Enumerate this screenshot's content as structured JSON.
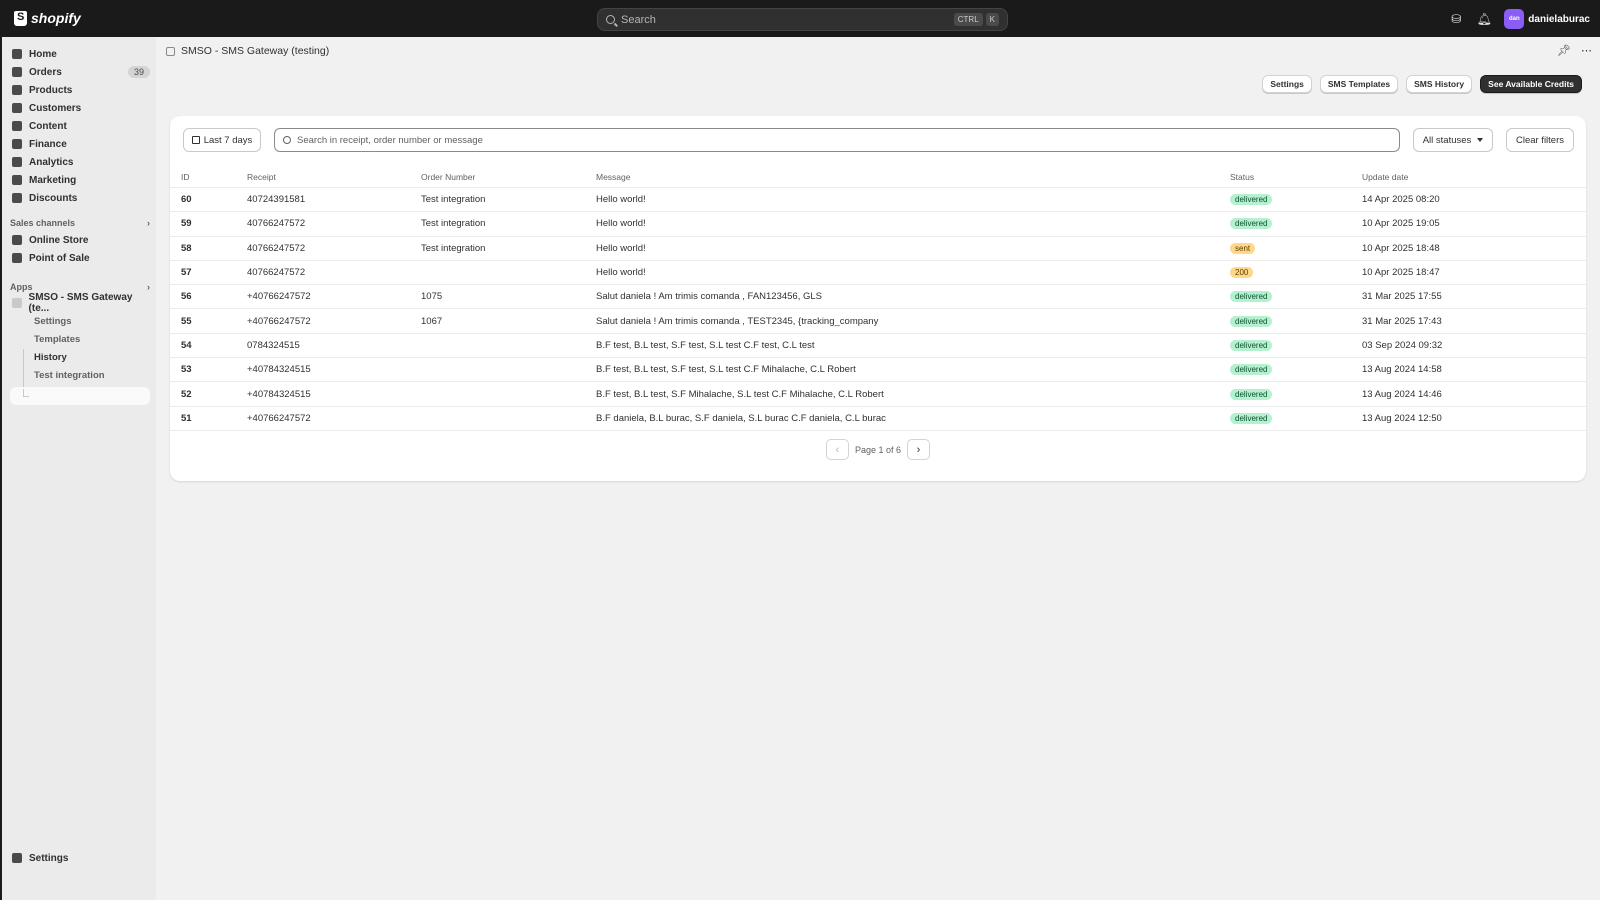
{
  "topbar": {
    "brand": "shopify",
    "search_placeholder": "Search",
    "shortcut_keys": [
      "CTRL",
      "K"
    ],
    "avatar_initials": "dan",
    "username": "danielaburac"
  },
  "sidebar": {
    "nav": [
      {
        "label": "Home",
        "icon": "home-icon"
      },
      {
        "label": "Orders",
        "icon": "orders-icon",
        "count": "39"
      },
      {
        "label": "Products",
        "icon": "tag-icon"
      },
      {
        "label": "Customers",
        "icon": "person-icon"
      },
      {
        "label": "Content",
        "icon": "content-icon"
      },
      {
        "label": "Finance",
        "icon": "bank-icon"
      },
      {
        "label": "Analytics",
        "icon": "chart-icon"
      },
      {
        "label": "Marketing",
        "icon": "target-icon"
      },
      {
        "label": "Discounts",
        "icon": "discount-icon"
      }
    ],
    "sales_channels_heading": "Sales channels",
    "sales_channels": [
      {
        "label": "Online Store",
        "icon": "store-icon"
      },
      {
        "label": "Point of Sale",
        "icon": "pos-icon"
      }
    ],
    "apps_heading": "Apps",
    "app_name": "SMSO - SMS Gateway (te...",
    "app_sub": [
      "Settings",
      "Templates",
      "History",
      "Test integration"
    ],
    "settings_label": "Settings"
  },
  "header": {
    "title": "SMSO - SMS Gateway (testing)",
    "pin_icon": "pin-icon",
    "more_icon": "more-icon"
  },
  "toolbar": {
    "settings": "Settings",
    "templates": "SMS Templates",
    "history": "SMS History",
    "credits": "See Available Credits"
  },
  "filters": {
    "date": "Last 7 days",
    "search_placeholder": "Search in receipt, order number or message",
    "status": "All statuses",
    "clear": "Clear filters"
  },
  "table": {
    "columns": [
      "ID",
      "Receipt",
      "Order Number",
      "Message",
      "Status",
      "Update date"
    ],
    "rows": [
      {
        "id": "60",
        "receipt": "40724391581",
        "order": "Test integration",
        "message": "Hello world!",
        "status": "delivered",
        "date": "14 Apr 2025 08:20"
      },
      {
        "id": "59",
        "receipt": "40766247572",
        "order": "Test integration",
        "message": "Hello world!",
        "status": "delivered",
        "date": "10 Apr 2025 19:05"
      },
      {
        "id": "58",
        "receipt": "40766247572",
        "order": "Test integration",
        "message": "Hello world!",
        "status": "sent",
        "date": "10 Apr 2025 18:48"
      },
      {
        "id": "57",
        "receipt": "40766247572",
        "order": "",
        "message": "Hello world!",
        "status": "200",
        "date": "10 Apr 2025 18:47"
      },
      {
        "id": "56",
        "receipt": "+40766247572",
        "order": "1075",
        "message": "Salut daniela ! Am trimis comanda , FAN123456, GLS",
        "status": "delivered",
        "date": "31 Mar 2025 17:55"
      },
      {
        "id": "55",
        "receipt": "+40766247572",
        "order": "1067",
        "message": "Salut daniela ! Am trimis comanda , TEST2345, {tracking_company",
        "status": "delivered",
        "date": "31 Mar 2025 17:43"
      },
      {
        "id": "54",
        "receipt": "0784324515",
        "order": "",
        "message": "B.F test, B.L test, S.F test, S.L test C.F test, C.L test",
        "status": "delivered",
        "date": "03 Sep 2024 09:32"
      },
      {
        "id": "53",
        "receipt": "+40784324515",
        "order": "",
        "message": "B.F test, B.L test, S.F test, S.L test C.F Mihalache, C.L Robert",
        "status": "delivered",
        "date": "13 Aug 2024 14:58"
      },
      {
        "id": "52",
        "receipt": "+40784324515",
        "order": "",
        "message": "B.F test, B.L test, S.F Mihalache, S.L test C.F Mihalache, C.L Robert",
        "status": "delivered",
        "date": "13 Aug 2024 14:46"
      },
      {
        "id": "51",
        "receipt": "+40766247572",
        "order": "",
        "message": "B.F daniela, B.L burac, S.F daniela, S.L burac C.F daniela, C.L burac",
        "status": "delivered",
        "date": "13 Aug 2024 12:50"
      }
    ]
  },
  "pagination": {
    "label": "Page 1 of 6"
  }
}
